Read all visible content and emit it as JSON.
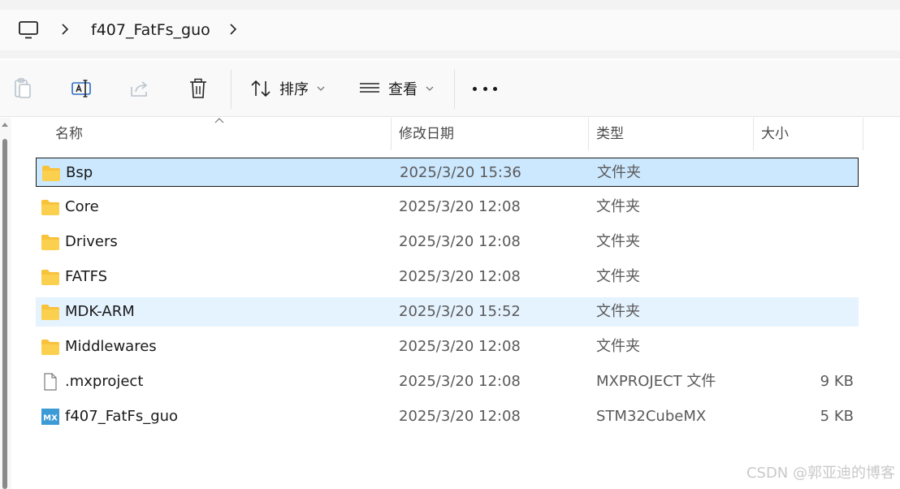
{
  "address": {
    "computer_icon": "pc-monitor-icon",
    "separator_icon": "chevron-right-icon",
    "crumbs": [
      "f407_FatFs_guo"
    ]
  },
  "toolbar": {
    "copy_icon": "clipboard-copy-icon",
    "rename_icon": "rename-icon",
    "share_icon": "share-icon",
    "delete_icon": "trash-icon",
    "sort_label": "排序",
    "sort_icon": "sort-arrows-icon",
    "view_label": "查看",
    "view_icon": "view-lines-icon",
    "more_icon": "more-dots-icon"
  },
  "columns": {
    "name": "名称",
    "date": "修改日期",
    "type": "类型",
    "size": "大小"
  },
  "files": [
    {
      "name": "Bsp",
      "date": "2025/3/20 15:36",
      "type": "文件夹",
      "size": "",
      "icon": "folder-icon",
      "state": "selected"
    },
    {
      "name": "Core",
      "date": "2025/3/20 12:08",
      "type": "文件夹",
      "size": "",
      "icon": "folder-icon",
      "state": ""
    },
    {
      "name": "Drivers",
      "date": "2025/3/20 12:08",
      "type": "文件夹",
      "size": "",
      "icon": "folder-icon",
      "state": ""
    },
    {
      "name": "FATFS",
      "date": "2025/3/20 12:08",
      "type": "文件夹",
      "size": "",
      "icon": "folder-icon",
      "state": ""
    },
    {
      "name": "MDK-ARM",
      "date": "2025/3/20 15:52",
      "type": "文件夹",
      "size": "",
      "icon": "folder-icon",
      "state": "hover"
    },
    {
      "name": "Middlewares",
      "date": "2025/3/20 12:08",
      "type": "文件夹",
      "size": "",
      "icon": "folder-icon",
      "state": ""
    },
    {
      "name": ".mxproject",
      "date": "2025/3/20 12:08",
      "type": "MXPROJECT 文件",
      "size": "9 KB",
      "icon": "blank-file-icon",
      "state": ""
    },
    {
      "name": "f407_FatFs_guo",
      "date": "2025/3/20 12:08",
      "type": "STM32CubeMX",
      "size": "5 KB",
      "icon": "stm32cubemx-icon",
      "state": ""
    }
  ],
  "mx_icon_text": "MX",
  "watermark": "CSDN @郭亚迪的博客",
  "colors": {
    "selected_bg": "#cce8ff",
    "hover_bg": "#e5f3ff",
    "folder_yellow": "#f8c23a",
    "mx_blue": "#3c9ad6"
  }
}
